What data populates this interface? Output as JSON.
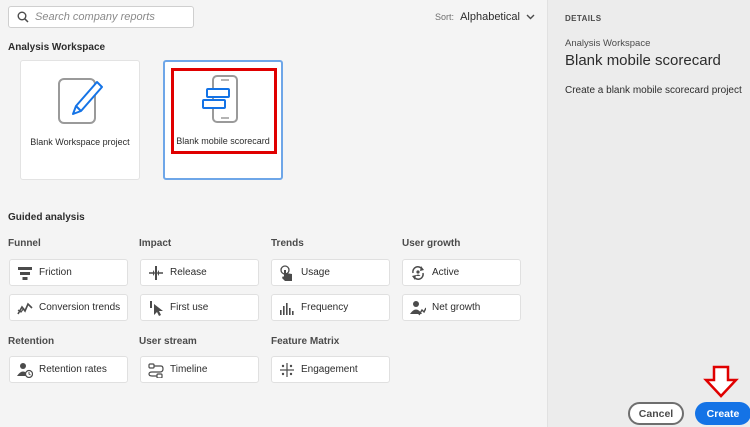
{
  "search": {
    "placeholder": "Search company reports"
  },
  "sort": {
    "label": "Sort:",
    "value": "Alphabetical"
  },
  "analysis_workspace": {
    "title": "Analysis Workspace",
    "cards": [
      {
        "label": "Blank Workspace project",
        "icon": "pencil-document-icon"
      },
      {
        "label": "Blank mobile scorecard",
        "icon": "mobile-scorecard-icon",
        "selected": true
      }
    ]
  },
  "guided": {
    "title": "Guided analysis",
    "categories": [
      {
        "name": "Funnel",
        "items": [
          "Friction",
          "Conversion trends"
        ]
      },
      {
        "name": "Impact",
        "items": [
          "Release",
          "First use"
        ]
      },
      {
        "name": "Trends",
        "items": [
          "Usage",
          "Frequency"
        ]
      },
      {
        "name": "User growth",
        "items": [
          "Active",
          "Net growth"
        ]
      },
      {
        "name": "Retention",
        "items": [
          "Retention rates"
        ]
      },
      {
        "name": "User stream",
        "items": [
          "Timeline"
        ]
      },
      {
        "name": "Feature Matrix",
        "items": [
          "Engagement"
        ]
      }
    ]
  },
  "details": {
    "heading": "DETAILS",
    "subtitle": "Analysis Workspace",
    "title": "Blank mobile scorecard",
    "description": "Create a blank mobile scorecard project"
  },
  "footer": {
    "cancel_label": "Cancel",
    "create_label": "Create"
  },
  "colors": {
    "accent": "#1473e6",
    "highlight": "#e00000",
    "selection": "#6ea6e8"
  }
}
